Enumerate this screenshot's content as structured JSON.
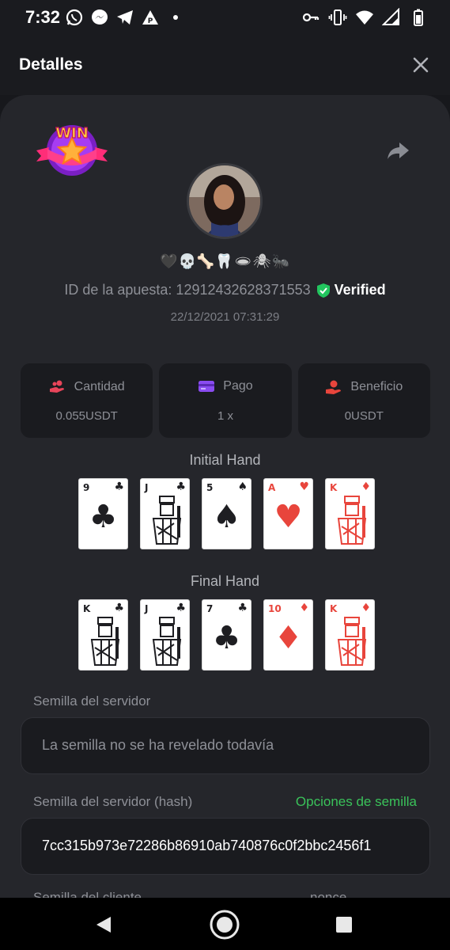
{
  "status_bar": {
    "time": "7:32",
    "left_icons": [
      "whatsapp-icon",
      "messenger-icon",
      "telegram-icon",
      "notification-app-icon",
      "dot-icon"
    ],
    "right_icons": [
      "key-icon",
      "vibrate-icon",
      "wifi-icon",
      "signal-icon",
      "battery-icon"
    ]
  },
  "header": {
    "title": "Detalles"
  },
  "win_badge": {
    "text": "WIN"
  },
  "profile": {
    "emojis": "🖤💀🦴🦷🕳🕷🐜"
  },
  "bet": {
    "id_text": "ID de la apuesta: 12912432628371553",
    "verified_label": "Verified",
    "date": "22/12/2021 07:31:29"
  },
  "stats": [
    {
      "label": "Cantidad",
      "value": "0.055USDT",
      "icon": "coins-hand-icon"
    },
    {
      "label": "Pago",
      "value": "1 x",
      "icon": "card-icon"
    },
    {
      "label": "Beneficio",
      "value": "0USDT",
      "icon": "profit-hand-icon"
    }
  ],
  "initial_hand": {
    "title": "Initial Hand",
    "cards": [
      {
        "rank": "9",
        "suit": "♣",
        "color": "black",
        "face": false
      },
      {
        "rank": "J",
        "suit": "♣",
        "color": "black",
        "face": true
      },
      {
        "rank": "5",
        "suit": "♠",
        "color": "black",
        "face": false
      },
      {
        "rank": "A",
        "suit": "♥",
        "color": "red",
        "face": false
      },
      {
        "rank": "K",
        "suit": "♦",
        "color": "red",
        "face": true
      }
    ]
  },
  "final_hand": {
    "title": "Final Hand",
    "cards": [
      {
        "rank": "K",
        "suit": "♣",
        "color": "black",
        "face": true
      },
      {
        "rank": "J",
        "suit": "♣",
        "color": "black",
        "face": true
      },
      {
        "rank": "7",
        "suit": "♣",
        "color": "black",
        "face": false
      },
      {
        "rank": "10",
        "suit": "♦",
        "color": "red",
        "face": false
      },
      {
        "rank": "K",
        "suit": "♦",
        "color": "red",
        "face": true
      }
    ]
  },
  "server_seed": {
    "label": "Semilla del servidor",
    "value": "La semilla no se ha revelado todavía"
  },
  "server_seed_hash": {
    "label": "Semilla del servidor (hash)",
    "options_link": "Opciones de semilla",
    "value": "7cc315b973e72286b86910ab740876c0f2bbc2456f1"
  },
  "client_seed": {
    "label": "Semilla del cliente",
    "nonce_label": "nonce"
  },
  "colors": {
    "background": "#17181c",
    "sheet": "#25262b",
    "box": "#1a1b1f",
    "accent_green": "#3ac25a",
    "red_suit": "#e8453c",
    "icon_pink": "#e8455a",
    "icon_purple": "#8a4cf0"
  }
}
